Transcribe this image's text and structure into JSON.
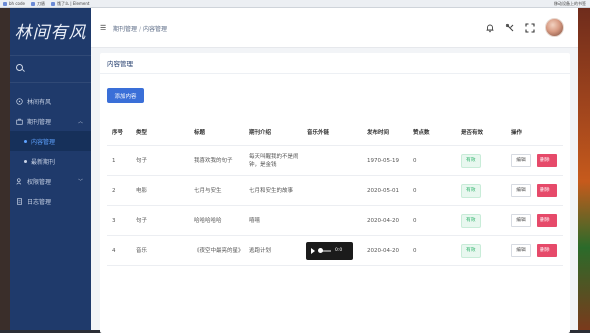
{
  "bookmarks": [
    "bh code",
    "刀盾",
    "饿了么 | Element"
  ],
  "bookmarks_right": "移动设备上的书签",
  "sidebar": {
    "logo": "林间有风",
    "search_placeholder": "",
    "items": [
      {
        "label": "林间有风",
        "icon": "compass-icon"
      },
      {
        "label": "期刊管理",
        "icon": "briefcase-icon",
        "expanded": true,
        "children": [
          {
            "label": "内容管理",
            "active": true
          },
          {
            "label": "最新期刊",
            "active": false
          }
        ]
      },
      {
        "label": "权限管理",
        "icon": "user-key-icon"
      },
      {
        "label": "日志管理",
        "icon": "document-icon"
      }
    ]
  },
  "header": {
    "breadcrumb": [
      "期刊管理",
      "内容管理"
    ],
    "breadcrumb_sep": "/",
    "icons": [
      "bell-icon",
      "tools-icon",
      "fullscreen-icon"
    ]
  },
  "card": {
    "title": "内容管理",
    "add_button": "添加内容"
  },
  "table": {
    "headers": [
      "序号",
      "类型",
      "标题",
      "期刊介绍",
      "音乐外链",
      "发布时间",
      "赞点数",
      "是否有效",
      "操作"
    ],
    "rows": [
      {
        "index": "1",
        "type": "句子",
        "title": "我喜欢我的句子",
        "intro": "每天叫醒我的不是闹钟，是金钱",
        "music": "",
        "date": "1970-05-19",
        "likes": "0",
        "status": "有效",
        "edit": "编辑",
        "delete": "删除"
      },
      {
        "index": "2",
        "type": "电影",
        "title": "七月与安生",
        "intro": "七月和安生的故事",
        "music": "",
        "date": "2020-05-01",
        "likes": "0",
        "status": "有效",
        "edit": "编辑",
        "delete": "删除"
      },
      {
        "index": "3",
        "type": "句子",
        "title": "哈哈哈哈哈",
        "intro": "嘻嘻",
        "music": "",
        "date": "2020-04-20",
        "likes": "0",
        "status": "有效",
        "edit": "编辑",
        "delete": "删除"
      },
      {
        "index": "4",
        "type": "音乐",
        "title": "《夜空中最亮的星》",
        "intro": "逃跑计划",
        "music": "0:0",
        "date": "2020-04-20",
        "likes": "0",
        "status": "有效",
        "edit": "编辑",
        "delete": "删除"
      }
    ]
  },
  "colors": {
    "sidebar": "#1f3a6b",
    "accent": "#3a6fd8",
    "danger": "#e64a6a",
    "success": "#2fb36b"
  }
}
